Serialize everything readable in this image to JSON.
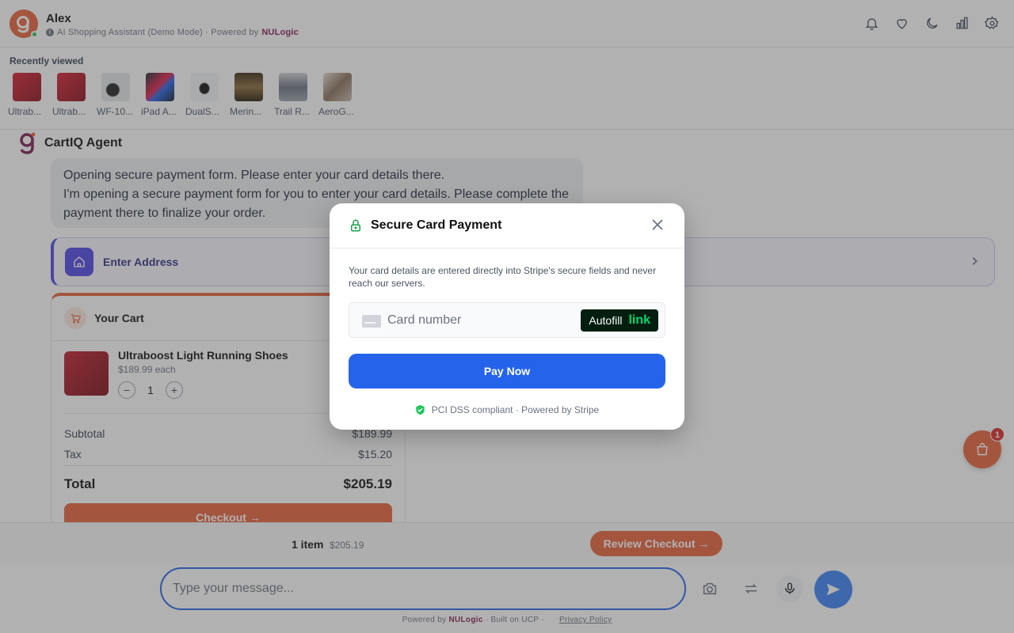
{
  "header": {
    "user_name": "Alex",
    "subtitle": "AI Shopping Assistant (Demo Mode) · Powered by",
    "brand": "NULogic",
    "icons": [
      "bell-icon",
      "heart-icon",
      "moon-icon",
      "bar-chart-icon",
      "gear-icon"
    ]
  },
  "recent": {
    "title": "Recently viewed",
    "items": [
      {
        "label": "Ultrab...",
        "color": "#c0182a"
      },
      {
        "label": "Ultrab...",
        "color": "#c0182a"
      },
      {
        "label": "WF-10...",
        "color": "#e5e7eb"
      },
      {
        "label": "iPad A...",
        "color": "#3b4b6b"
      },
      {
        "label": "DualS...",
        "color": "#f3f4f6"
      },
      {
        "label": "Merin...",
        "color": "#6b4a2a"
      },
      {
        "label": "Trail R...",
        "color": "#9ca3af"
      },
      {
        "label": "AeroG...",
        "color": "#b0a8a0"
      }
    ]
  },
  "chat": {
    "agent_name": "CartIQ Agent",
    "message_line1": "Opening secure payment form. Please enter your card details there.",
    "message_line2": "I'm opening a secure payment form for you to enter your card details. Please complete the payment there to finalize your order.",
    "address_label": "Enter Address"
  },
  "cart": {
    "title": "Your Cart",
    "item_name": "Ultraboost Light Running Shoes",
    "item_price": "$189.99 each",
    "quantity": "1",
    "minus": "−",
    "plus": "+",
    "subtotal_label": "Subtotal",
    "subtotal_value": "$189.99",
    "tax_label": "Tax",
    "tax_value": "$15.20",
    "total_label": "Total",
    "total_value": "$205.19",
    "checkout_label": "Checkout →"
  },
  "summary": {
    "items": "1 item",
    "amount": "$205.19",
    "review_label": "Review Checkout →"
  },
  "input": {
    "placeholder": "Type your message..."
  },
  "footer": {
    "powered_by": "Powered by",
    "brand": "NULogic",
    "built_on": "· Built on UCP ·",
    "privacy": "Privacy Policy"
  },
  "fab": {
    "badge": "1"
  },
  "modal": {
    "title": "Secure Card Payment",
    "description": "Your card details are entered directly into Stripe's secure fields and never reach our servers.",
    "card_placeholder": "Card number",
    "autofill_label": "Autofill",
    "autofill_link": "link",
    "pay_label": "Pay Now",
    "compliance": "PCI DSS compliant · Powered by Stripe"
  },
  "colors": {
    "accent": "#e8613a",
    "primary_blue": "#2563eb",
    "brand": "#7c1d4f",
    "indigo": "#4f46e5",
    "success": "#16a34a"
  }
}
